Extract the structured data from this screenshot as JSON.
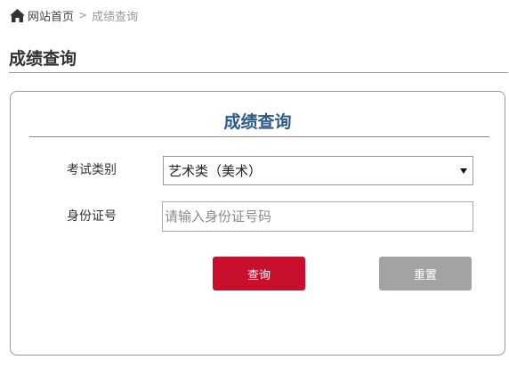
{
  "breadcrumb": {
    "home_icon": "home-icon",
    "home_label": "网站首页",
    "separator": ">",
    "current": "成绩查询"
  },
  "page": {
    "title": "成绩查询"
  },
  "form": {
    "title": "成绩查询",
    "exam_type_label": "考试类别",
    "exam_type_value": "艺术类（美术）",
    "id_label": "身份证号",
    "id_placeholder": "请输入身份证号码",
    "id_value": "",
    "query_button": "查询",
    "reset_button": "重置"
  },
  "colors": {
    "accent_title": "#2a5b8a",
    "query_button": "#c8102e",
    "reset_button": "#a3a3a3"
  }
}
